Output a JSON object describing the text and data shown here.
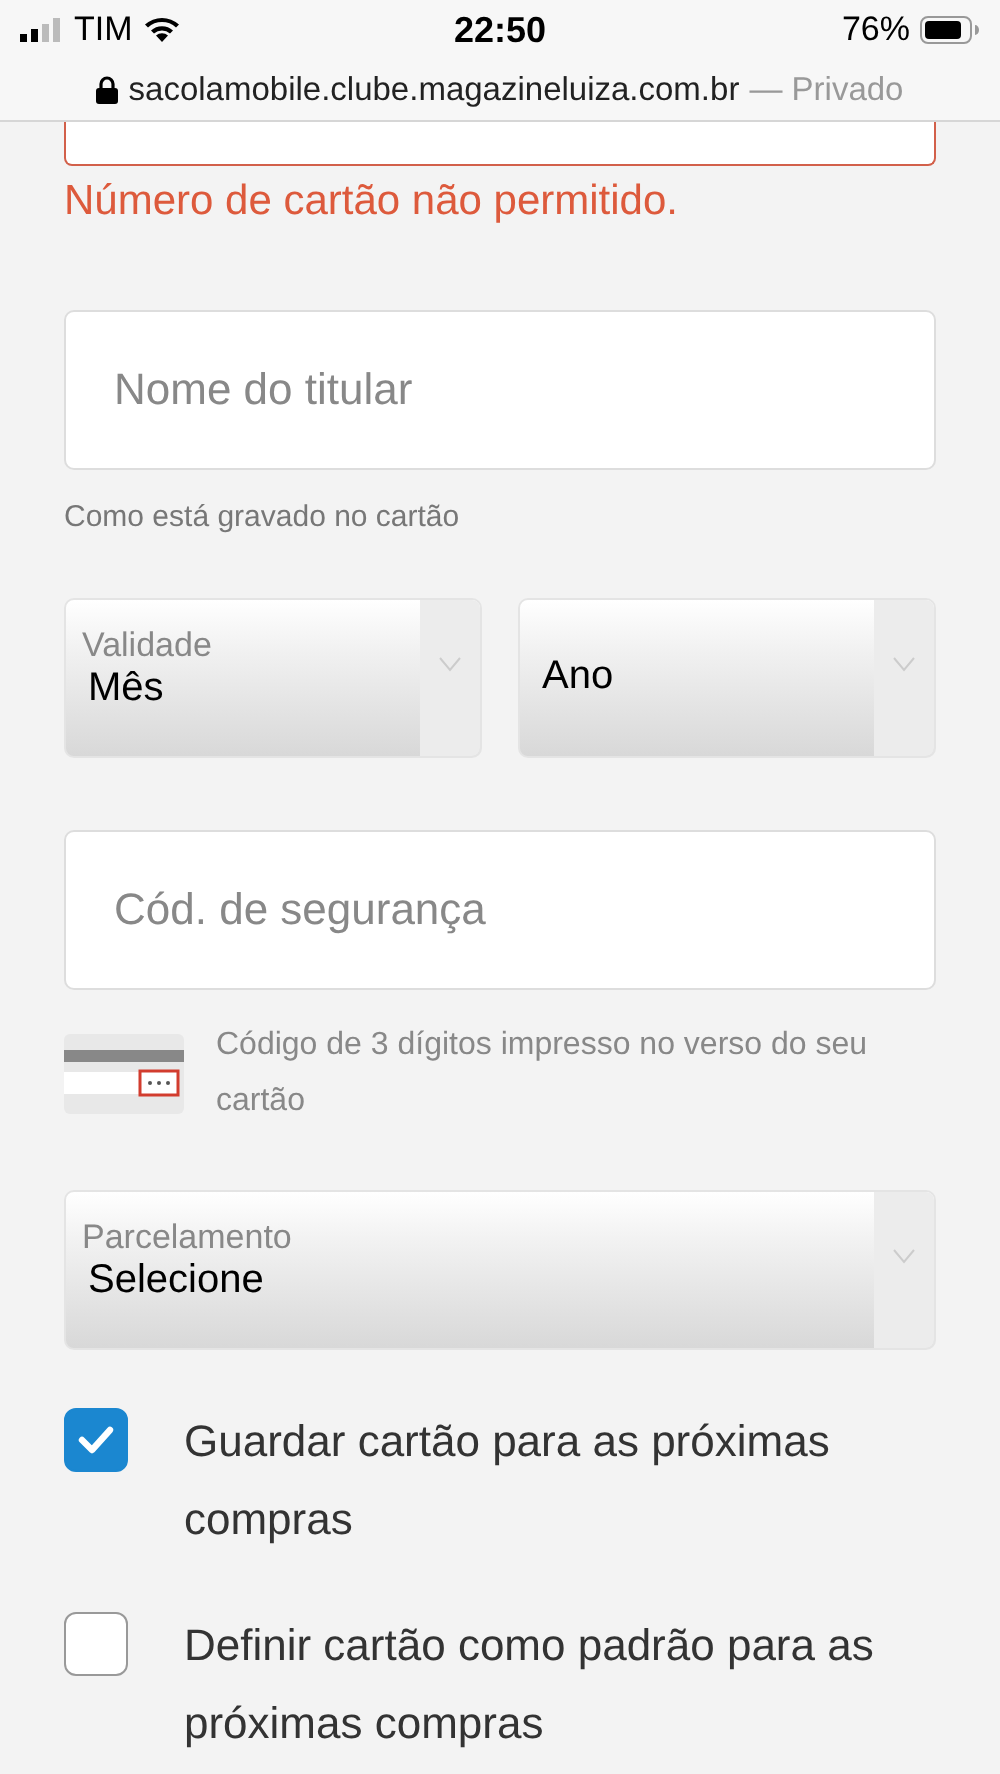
{
  "status_bar": {
    "carrier": "TIM",
    "time": "22:50",
    "battery": "76%"
  },
  "address_bar": {
    "domain": "sacolamobile.clube.magazineluiza.com.br",
    "mode": "— Privado"
  },
  "card_number": {
    "error": "Número de cartão não permitido."
  },
  "holder_name": {
    "placeholder": "Nome do titular",
    "hint": "Como está gravado no cartão"
  },
  "expiry": {
    "label": "Validade",
    "selects": [
      {
        "value": "Mês"
      },
      {
        "value": "Ano"
      }
    ]
  },
  "security_code": {
    "placeholder": "Cód. de segurança",
    "hint": "Código de 3 dígitos impresso no verso do seu cartão"
  },
  "installments": {
    "label": "Parcelamento",
    "value": "Selecione"
  },
  "options": [
    {
      "label": "Guardar cartão para as próximas compras",
      "checked": true
    },
    {
      "label": "Definir cartão como padrão para as próximas compras",
      "checked": false
    }
  ]
}
